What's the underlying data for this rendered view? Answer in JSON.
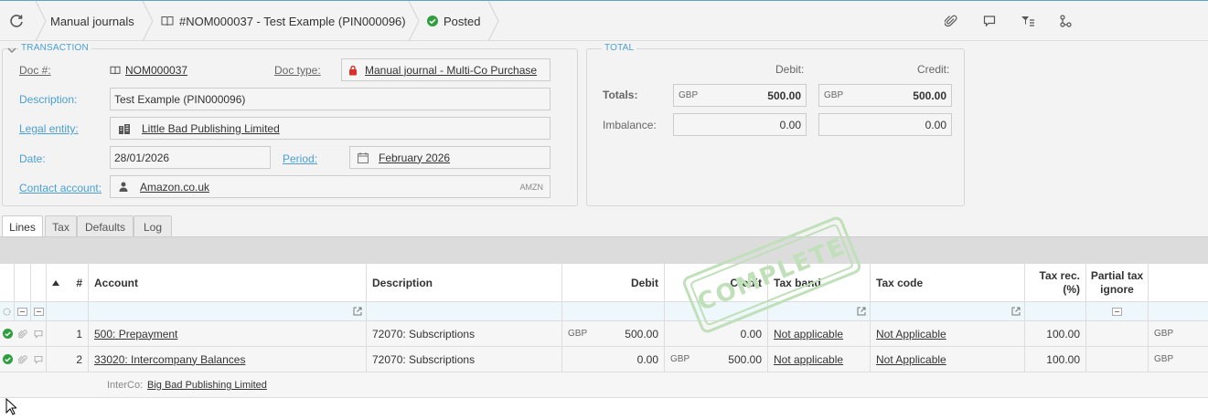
{
  "header": {
    "title": "Manual journals",
    "record": "#NOM000037 - Test Example (PIN000096)",
    "status": "Posted"
  },
  "transaction": {
    "legend": "TRANSACTION",
    "doc_no_label": "Doc #:",
    "doc_no": "NOM000037",
    "doc_type_label": "Doc type:",
    "doc_type": "Manual journal - Multi-Co Purchase",
    "description_label": "Description:",
    "description": "Test Example (PIN000096)",
    "legal_entity_label": "Legal entity:",
    "legal_entity": "Little Bad Publishing Limited",
    "date_label": "Date:",
    "date": "28/01/2026",
    "period_label": "Period:",
    "period": "February 2026",
    "contact_label": "Contact account:",
    "contact": "Amazon.co.uk",
    "contact_code": "AMZN"
  },
  "total": {
    "legend": "TOTAL",
    "debit_label": "Debit:",
    "credit_label": "Credit:",
    "totals_label": "Totals:",
    "imbalance_label": "Imbalance:",
    "currency": "GBP",
    "total_debit": "500.00",
    "total_credit": "500.00",
    "imbalance_debit": "0.00",
    "imbalance_credit": "0.00"
  },
  "tabs": [
    "Lines",
    "Tax",
    "Defaults",
    "Log"
  ],
  "grid": {
    "columns": {
      "num": "#",
      "account": "Account",
      "description": "Description",
      "debit": "Debit",
      "credit": "Credit",
      "tax_band": "Tax band",
      "tax_code": "Tax code",
      "tax_rec": "Tax rec. (%)",
      "partial_tax": "Partial tax ignore"
    },
    "rows": [
      {
        "num": "1",
        "account": "500: Prepayment",
        "description": "72070: Subscriptions",
        "debit_cur": "GBP",
        "debit": "500.00",
        "credit_cur": "",
        "credit": "0.00",
        "tax_band": "Not applicable",
        "tax_code": "Not Applicable",
        "tax_rec": "100.00",
        "cur": "GBP"
      },
      {
        "num": "2",
        "account": "33020: Intercompany Balances",
        "description": "72070: Subscriptions",
        "debit_cur": "",
        "debit": "0.00",
        "credit_cur": "GBP",
        "credit": "500.00",
        "tax_band": "Not applicable",
        "tax_code": "Not Applicable",
        "tax_rec": "100.00",
        "cur": "GBP"
      }
    ],
    "interco_label": "InterCo:",
    "interco_value": "Big Bad Publishing Limited"
  },
  "stamp": "COMPLETE",
  "colors": {
    "accent": "#4a9fd4",
    "success": "#2e9e3e",
    "lock": "#d9302c",
    "stamp": "#bfe0b8"
  }
}
